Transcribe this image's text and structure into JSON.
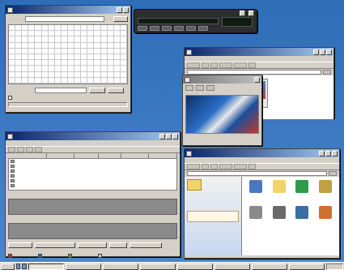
{
  "desktop": {
    "background_color": "#3f7cc4"
  },
  "charmap": {
    "title": "",
    "font_label": "",
    "font_value": "",
    "help_label": "",
    "copy_label": "",
    "copy_value": "",
    "select_label": "",
    "copy_button": "",
    "advanced_label": "",
    "status": ""
  },
  "player": {
    "title": "",
    "status": "",
    "time": ""
  },
  "pictures": {
    "title": "",
    "address": "",
    "heading": "",
    "thumb_caption": "",
    "menu": [
      "",
      "",
      "",
      "",
      "",
      ""
    ]
  },
  "viewer": {
    "title": ""
  },
  "disks": {
    "title": "",
    "menu": [
      "",
      "",
      "",
      ""
    ],
    "columns": [
      "",
      "",
      "",
      "",
      "",
      ""
    ],
    "section_labels": [
      "",
      ""
    ],
    "buttons": [
      "",
      "",
      "",
      "",
      ""
    ],
    "legend": [
      {
        "label": "",
        "color": "#c0392b"
      },
      {
        "label": "",
        "color": "#2f6db8"
      },
      {
        "label": "",
        "color": "#7a9a2a"
      },
      {
        "label": "",
        "color": "#d4d0c8"
      }
    ]
  },
  "folder": {
    "title": "",
    "address": "",
    "heading": "",
    "menu": [
      "",
      "",
      "",
      "",
      "",
      ""
    ],
    "items": [
      {
        "label": "",
        "icon": "network-icon",
        "color": "#4a78c0"
      },
      {
        "label": "",
        "icon": "folder-icon",
        "color": "#f2d36b"
      },
      {
        "label": "",
        "icon": "help-icon",
        "color": "#2f9a4a"
      },
      {
        "label": "",
        "icon": "settings-icon",
        "color": "#c0a040"
      },
      {
        "label": "",
        "icon": "printer-icon",
        "color": "#8a8a8a"
      },
      {
        "label": "",
        "icon": "drive-icon",
        "color": "#6a6a6a"
      },
      {
        "label": "",
        "icon": "monitor-icon",
        "color": "#3a6ea5"
      },
      {
        "label": "",
        "icon": "user-icon",
        "color": "#d07030"
      }
    ]
  },
  "taskbar": {
    "start_label": "",
    "tasks": [
      "",
      "",
      "",
      "",
      "",
      "",
      "",
      ""
    ],
    "clock": ""
  }
}
